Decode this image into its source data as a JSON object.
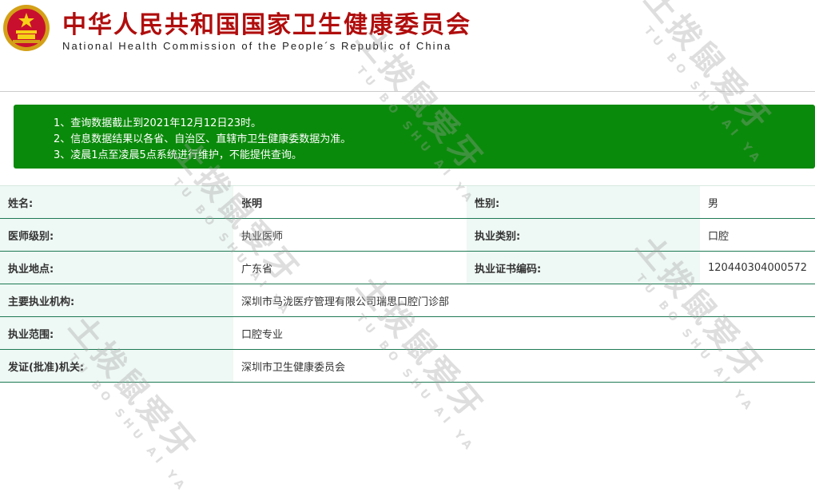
{
  "header": {
    "title_cn": "中华人民共和国国家卫生健康委员会",
    "title_en": "National Health Commission of the People´s Republic of China",
    "emblem_icon": "national-emblem-icon"
  },
  "notice": {
    "lines": [
      "1、查询数据截止到2021年12月12日23时。",
      "2、信息数据结果以各省、自治区、直辖市卫生健康委数据为准。",
      "3、凌晨1点至凌晨5点系统进行维护，不能提供查询。"
    ],
    "background_color": "#0a8a0a"
  },
  "info": {
    "row1": {
      "label_a": "姓名:",
      "value_a": "张明",
      "label_b": "性别:",
      "value_b": "男"
    },
    "row2": {
      "label_a": "医师级别:",
      "value_a": "执业医师",
      "label_b": "执业类别:",
      "value_b": "口腔"
    },
    "row3": {
      "label_a": "执业地点:",
      "value_a": "广东省",
      "label_b": "执业证书编码:",
      "value_b": "120440304000572"
    },
    "row4": {
      "label": "主要执业机构:",
      "value": "深圳市马泷医疗管理有限公司瑞思口腔门诊部"
    },
    "row5": {
      "label": "执业范围:",
      "value": "口腔专业"
    },
    "row6": {
      "label": "发证(批准)机关:",
      "value": "深圳市卫生健康委员会"
    }
  },
  "watermark": {
    "text": "土拨鼠爱牙",
    "sub": "TU BO SHU AI YA"
  },
  "colors": {
    "title_red": "#b00d0d",
    "notice_green": "#0a8a0a",
    "label_bg": "#eef8f4",
    "row_border": "#1f7a55"
  }
}
